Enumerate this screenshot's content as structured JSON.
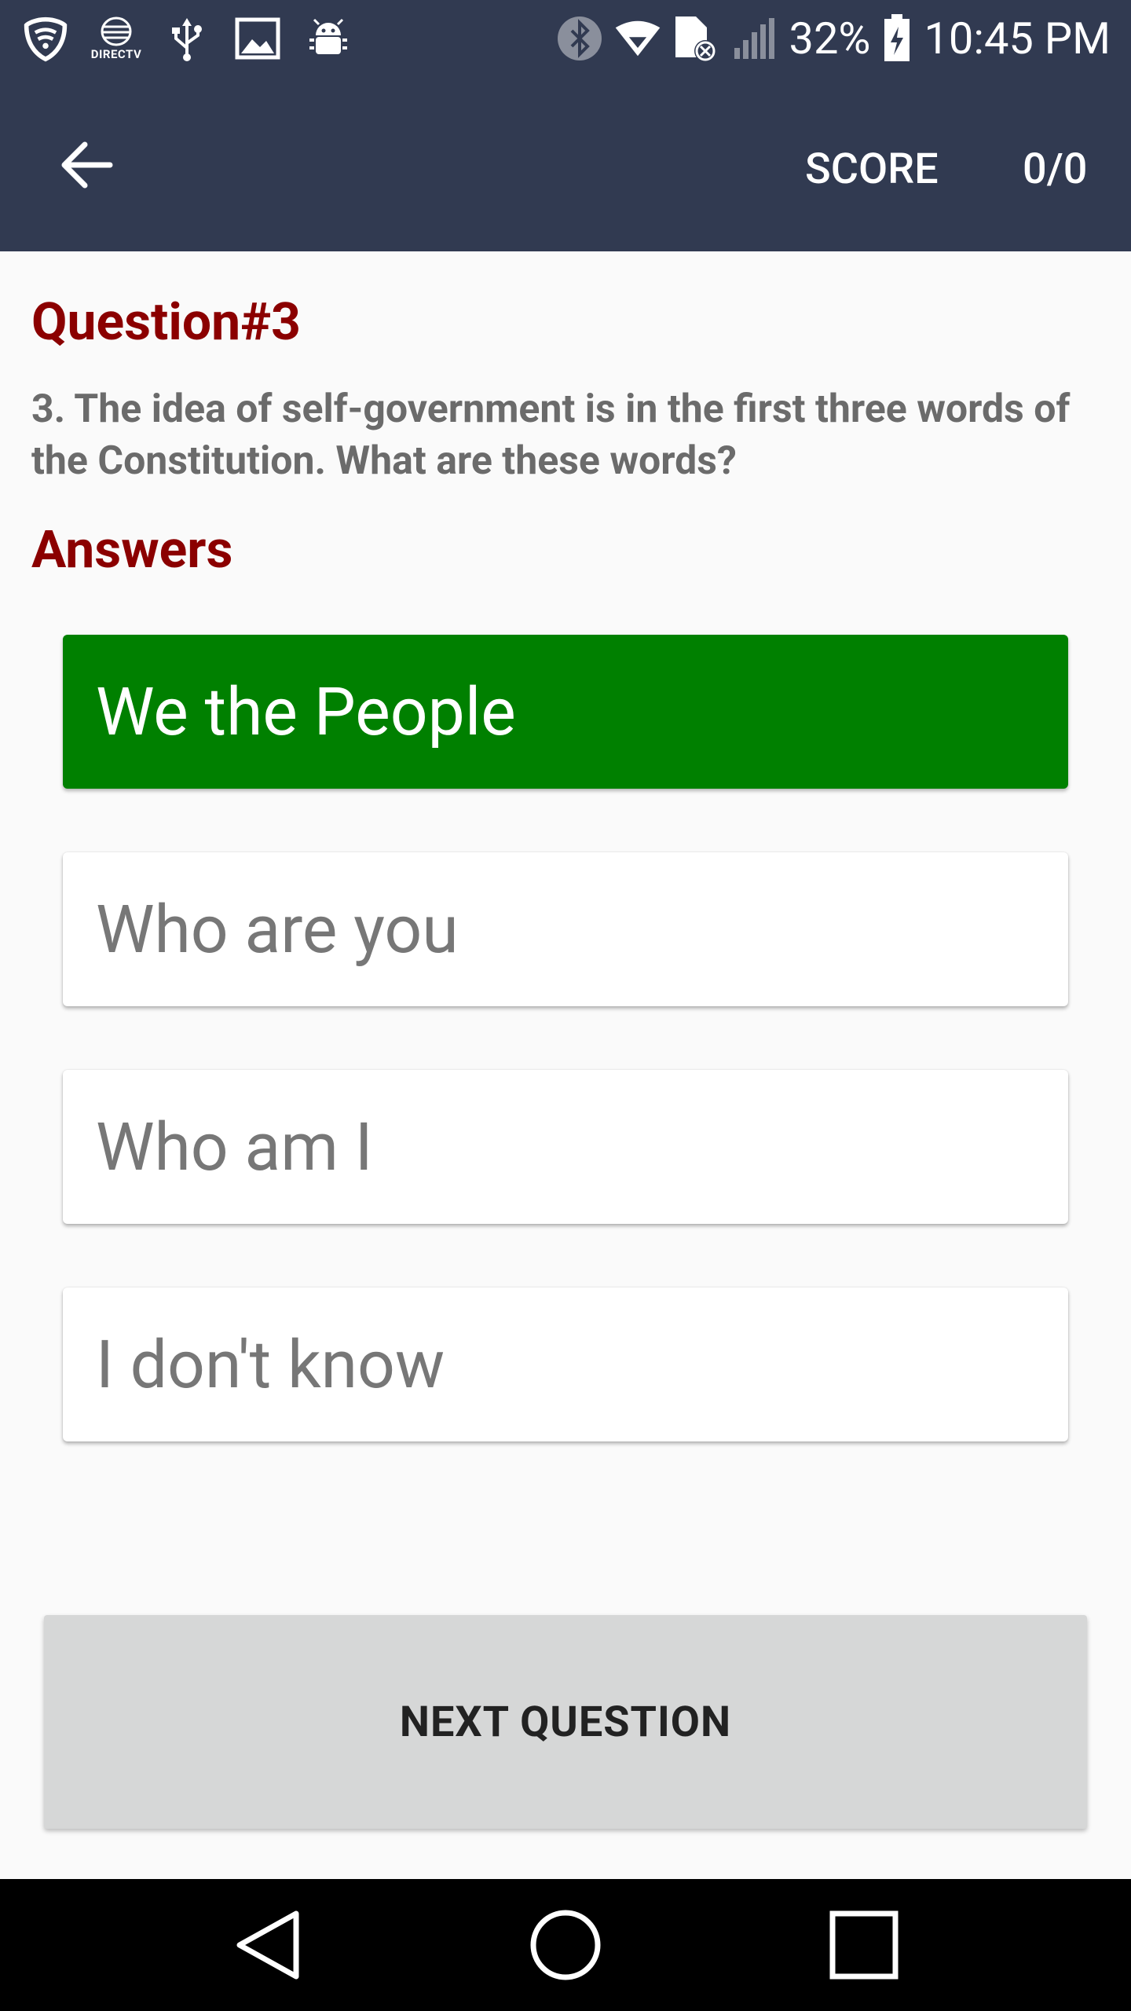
{
  "status_bar": {
    "carrier_small": "DIRECTV",
    "battery": "32%",
    "time": "10:45 PM",
    "left_icons": [
      "shield-icon",
      "att-directv-icon",
      "usb-icon",
      "image-icon",
      "android-debug-icon"
    ],
    "right_icons": [
      "bluetooth-icon",
      "wifi-icon",
      "sim-error-icon",
      "signal-icon",
      "battery-icon"
    ]
  },
  "app_bar": {
    "back_icon": "arrow-left-icon",
    "score_label": "SCORE",
    "score_value": "0/0",
    "background_color": "#313a51"
  },
  "question": {
    "title": "Question#3",
    "text": "3. The idea of self-government is in the first three words of the Constitution. What are these words?"
  },
  "answers_title": "Answers",
  "answers": [
    {
      "label": "We the People",
      "state": "correct"
    },
    {
      "label": "Who are you",
      "state": "default"
    },
    {
      "label": "Who am I",
      "state": "default"
    },
    {
      "label": "I don't know",
      "state": "default"
    }
  ],
  "next_button": {
    "label": "NEXT QUESTION"
  },
  "colors": {
    "heading": "#8b0000",
    "correct": "#008000",
    "question_text": "#6b6b6b"
  },
  "nav_bar": {
    "icons": [
      "back-triangle-icon",
      "home-circle-icon",
      "recents-square-icon"
    ]
  }
}
